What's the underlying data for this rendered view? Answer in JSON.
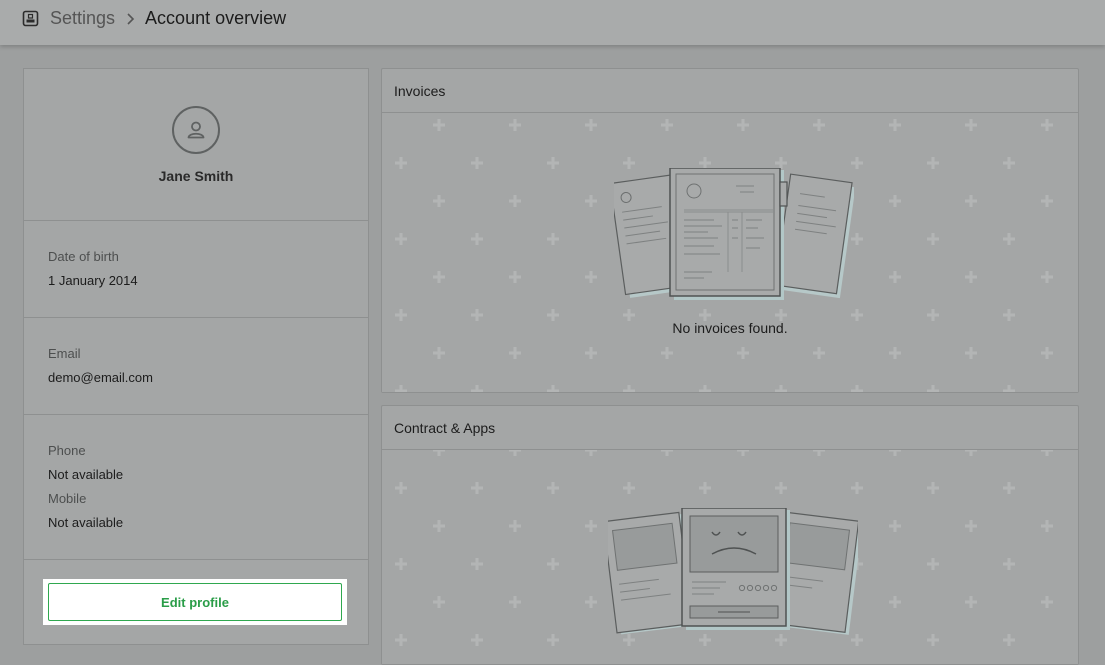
{
  "header": {
    "icon": "app-window-icon",
    "breadcrumb_parent": "Settings",
    "breadcrumb_separator_icon": "chevron-right-icon",
    "breadcrumb_current": "Account overview"
  },
  "profile": {
    "avatar_icon": "user-icon",
    "name": "Jane Smith",
    "dob_label": "Date of birth",
    "dob_value": "1 January 2014",
    "email_label": "Email",
    "email_value": "demo@email.com",
    "phone_label": "Phone",
    "phone_value": "Not available",
    "mobile_label": "Mobile",
    "mobile_value": "Not available",
    "edit_button": "Edit profile"
  },
  "invoices": {
    "title": "Invoices",
    "empty_message": "No invoices found."
  },
  "contracts": {
    "title": "Contract & Apps"
  },
  "colors": {
    "accent_green": "#2fa84f",
    "overlay_gray": "#a4a6a6"
  }
}
